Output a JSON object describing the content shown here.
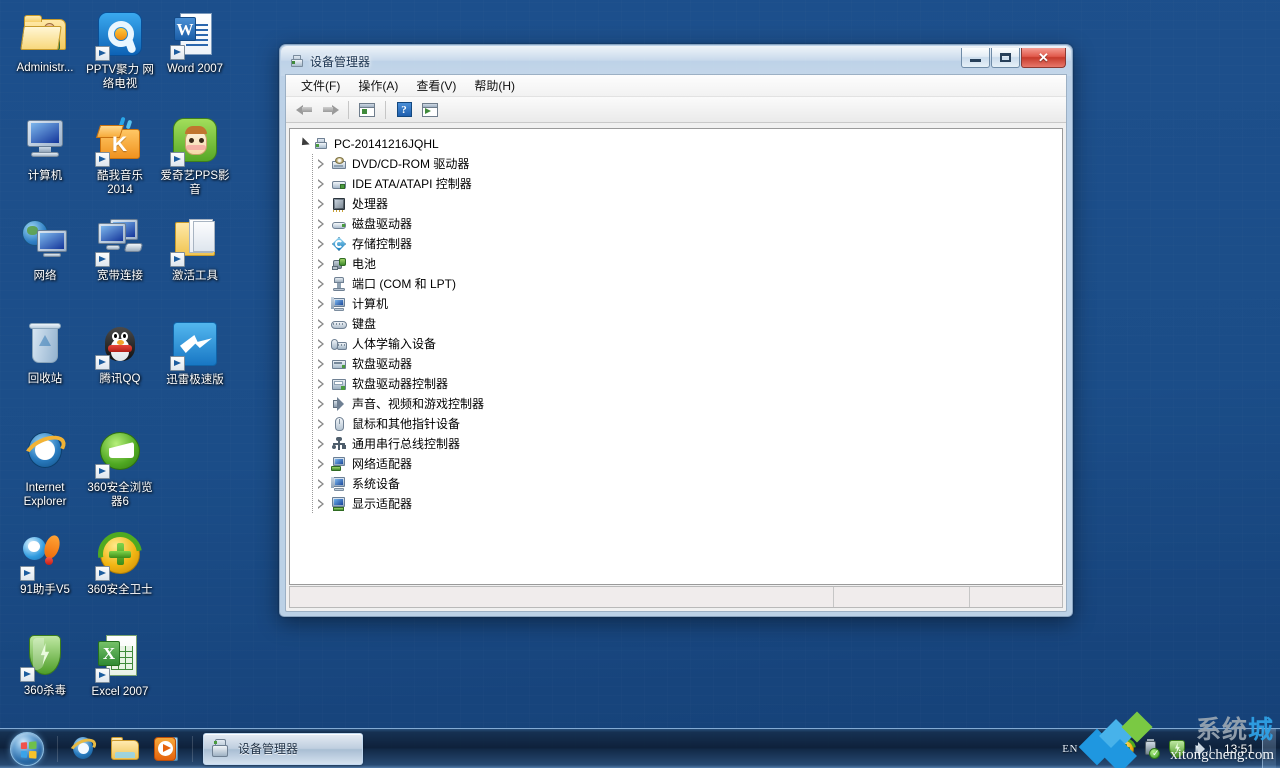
{
  "desktop": {
    "icons": [
      {
        "label": "Administr...",
        "art": "folder-user",
        "shortcut": false
      },
      {
        "label": "PPTV聚力 网络电视",
        "art": "pptv",
        "shortcut": true
      },
      {
        "label": "Word 2007",
        "art": "word",
        "shortcut": true
      },
      {
        "label": "计算机",
        "art": "computer",
        "shortcut": false
      },
      {
        "label": "酷我音乐 2014",
        "art": "kuwo",
        "shortcut": true
      },
      {
        "label": "爱奇艺PPS影音",
        "art": "pps",
        "shortcut": true
      },
      {
        "label": "网络",
        "art": "network",
        "shortcut": false
      },
      {
        "label": "宽带连接",
        "art": "broadband",
        "shortcut": true
      },
      {
        "label": "激活工具",
        "art": "folder2",
        "shortcut": true
      },
      {
        "label": "回收站",
        "art": "recycle",
        "shortcut": false
      },
      {
        "label": "腾讯QQ",
        "art": "qq",
        "shortcut": true
      },
      {
        "label": "迅雷极速版",
        "art": "thunder",
        "shortcut": true
      },
      {
        "label": "Internet Explorer",
        "art": "ie",
        "shortcut": false
      },
      {
        "label": "360安全浏览器6",
        "art": "360browser",
        "shortcut": true
      },
      {
        "label": "91助手V5",
        "art": "91",
        "shortcut": true
      },
      {
        "label": "360安全卫士",
        "art": "360safe",
        "shortcut": true
      },
      {
        "label": "360杀毒",
        "art": "360kill",
        "shortcut": true
      },
      {
        "label": "Excel 2007",
        "art": "excel",
        "shortcut": true
      }
    ]
  },
  "window": {
    "title": "设备管理器",
    "title_icon": "device-manager-icon",
    "buttons": {
      "minimize": "minimize-button",
      "maximize": "maximize-button",
      "close": "close-button",
      "close_glyph": "✕"
    },
    "menu": [
      {
        "label": "文件(F)",
        "name": "menu-file"
      },
      {
        "label": "操作(A)",
        "name": "menu-action"
      },
      {
        "label": "查看(V)",
        "name": "menu-view"
      },
      {
        "label": "帮助(H)",
        "name": "menu-help"
      }
    ],
    "toolbar": [
      {
        "name": "back-button",
        "icon": "arrow-back-icon"
      },
      {
        "name": "forward-button",
        "icon": "arrow-forward-icon"
      },
      {
        "name": "separator-1",
        "icon": "separator"
      },
      {
        "name": "properties-button",
        "icon": "properties-icon"
      },
      {
        "name": "separator-2",
        "icon": "separator"
      },
      {
        "name": "help-button",
        "icon": "help-icon",
        "glyph": "?"
      },
      {
        "name": "scan-hardware-button",
        "icon": "scan-hardware-icon"
      }
    ],
    "tree": {
      "root": {
        "label": "PC-20141216JQHL",
        "icon": "computer-node-icon",
        "expanded": true
      },
      "children": [
        {
          "label": "DVD/CD-ROM 驱动器",
          "icon": "dvd-drive-icon",
          "art": "di-dvd"
        },
        {
          "label": "IDE ATA/ATAPI 控制器",
          "icon": "ide-controller-icon",
          "art": "di-ide"
        },
        {
          "label": "处理器",
          "icon": "processor-icon",
          "art": "di-cpu"
        },
        {
          "label": "磁盘驱动器",
          "icon": "disk-drive-icon",
          "art": "di-disk"
        },
        {
          "label": "存储控制器",
          "icon": "storage-controller-icon",
          "art": "di-storage"
        },
        {
          "label": "电池",
          "icon": "battery-icon",
          "art": "di-batt"
        },
        {
          "label": "端口 (COM 和 LPT)",
          "icon": "ports-icon",
          "art": "di-port"
        },
        {
          "label": "计算机",
          "icon": "computer-icon",
          "art": "di-comp"
        },
        {
          "label": "键盘",
          "icon": "keyboard-icon",
          "art": "di-kb"
        },
        {
          "label": "人体学输入设备",
          "icon": "hid-icon",
          "art": "di-hid"
        },
        {
          "label": "软盘驱动器",
          "icon": "floppy-drive-icon",
          "art": "di-floppy"
        },
        {
          "label": "软盘驱动器控制器",
          "icon": "floppy-controller-icon",
          "art": "di-fdc"
        },
        {
          "label": "声音、视频和游戏控制器",
          "icon": "sound-video-game-icon",
          "art": "di-sound"
        },
        {
          "label": "鼠标和其他指针设备",
          "icon": "mouse-icon",
          "art": "di-mouse"
        },
        {
          "label": "通用串行总线控制器",
          "icon": "usb-controller-icon",
          "art": "di-usb"
        },
        {
          "label": "网络适配器",
          "icon": "network-adapter-icon",
          "art": "di-net"
        },
        {
          "label": "系统设备",
          "icon": "system-device-icon",
          "art": "di-sys"
        },
        {
          "label": "显示适配器",
          "icon": "display-adapter-icon",
          "art": "di-disp"
        }
      ]
    },
    "statusbar": {
      "pane1": "",
      "pane2": "",
      "pane3": ""
    }
  },
  "taskbar": {
    "start_button": "start-orb",
    "quick_launch": [
      {
        "name": "quicklaunch-internet-explorer",
        "icon": "internet-explorer-icon"
      },
      {
        "name": "quicklaunch-windows-explorer",
        "icon": "folder-icon"
      },
      {
        "name": "quicklaunch-media-player",
        "icon": "media-player-icon"
      }
    ],
    "task_buttons": [
      {
        "label": "设备管理器",
        "icon": "device-manager-icon",
        "active": true
      }
    ],
    "tray": {
      "language": "EN",
      "icons": [
        {
          "name": "tray-kuwo-music",
          "icon": "kuwo-icon"
        },
        {
          "name": "tray-360-safe",
          "icon": "360-safe-icon"
        },
        {
          "name": "tray-usb-safely-remove",
          "icon": "usb-icon"
        },
        {
          "name": "tray-360-antivirus",
          "icon": "shield-icon"
        },
        {
          "name": "tray-volume",
          "icon": "volume-icon"
        }
      ],
      "clock": "13:51"
    }
  },
  "watermark": {
    "cn_part1": "系统",
    "cn_part2": "城",
    "en": "xitongcheng.com"
  }
}
